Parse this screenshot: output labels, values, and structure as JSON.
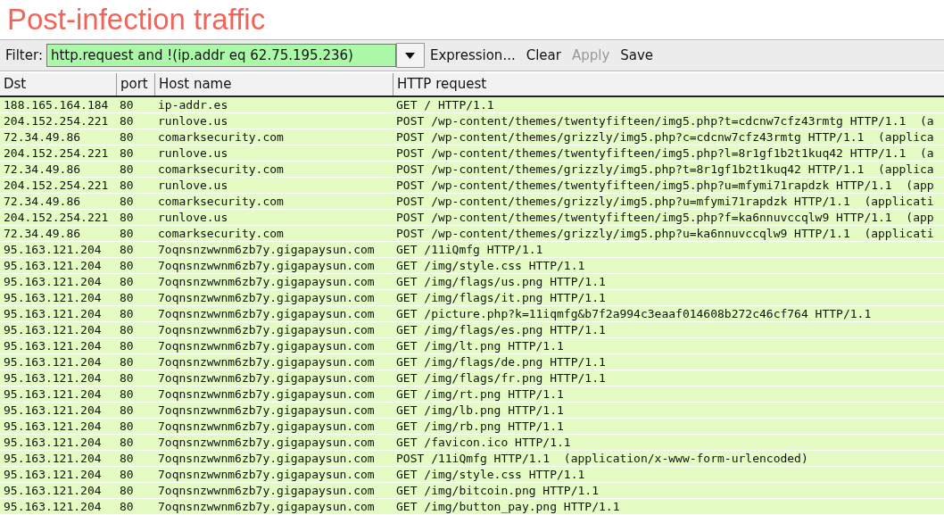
{
  "title": "Post-infection traffic",
  "filter": {
    "label": "Filter:",
    "value": "http.request and !(ip.addr eq 62.75.195.236)"
  },
  "toolbar": [
    {
      "label": "Expression...",
      "disabled": false
    },
    {
      "label": "Clear",
      "disabled": false
    },
    {
      "label": "Apply",
      "disabled": true
    },
    {
      "label": "Save",
      "disabled": false
    }
  ],
  "table": {
    "columns": [
      "Dst",
      "port",
      "Host name",
      "HTTP request"
    ],
    "rows": [
      [
        "188.165.164.184",
        "80",
        "ip-addr.es",
        "GET / HTTP/1.1"
      ],
      [
        "204.152.254.221",
        "80",
        "runlove.us",
        "POST /wp-content/themes/twentyfifteen/img5.php?t=cdcnw7cfz43rmtg HTTP/1.1  (a"
      ],
      [
        "72.34.49.86",
        "80",
        "comarksecurity.com",
        "POST /wp-content/themes/grizzly/img5.php?c=cdcnw7cfz43rmtg HTTP/1.1  (applica"
      ],
      [
        "204.152.254.221",
        "80",
        "runlove.us",
        "POST /wp-content/themes/twentyfifteen/img5.php?l=8r1gf1b2t1kuq42 HTTP/1.1  (a"
      ],
      [
        "72.34.49.86",
        "80",
        "comarksecurity.com",
        "POST /wp-content/themes/grizzly/img5.php?t=8r1gf1b2t1kuq42 HTTP/1.1  (applica"
      ],
      [
        "204.152.254.221",
        "80",
        "runlove.us",
        "POST /wp-content/themes/twentyfifteen/img5.php?u=mfymi71rapdzk HTTP/1.1  (app"
      ],
      [
        "72.34.49.86",
        "80",
        "comarksecurity.com",
        "POST /wp-content/themes/grizzly/img5.php?u=mfymi71rapdzk HTTP/1.1  (applicati"
      ],
      [
        "204.152.254.221",
        "80",
        "runlove.us",
        "POST /wp-content/themes/twentyfifteen/img5.php?f=ka6nnuvccqlw9 HTTP/1.1  (app"
      ],
      [
        "72.34.49.86",
        "80",
        "comarksecurity.com",
        "POST /wp-content/themes/grizzly/img5.php?u=ka6nnuvccqlw9 HTTP/1.1  (applicati"
      ],
      [
        "95.163.121.204",
        "80",
        "7oqnsnzwwnm6zb7y.gigapaysun.com",
        "GET /11iQmfg HTTP/1.1"
      ],
      [
        "95.163.121.204",
        "80",
        "7oqnsnzwwnm6zb7y.gigapaysun.com",
        "GET /img/style.css HTTP/1.1"
      ],
      [
        "95.163.121.204",
        "80",
        "7oqnsnzwwnm6zb7y.gigapaysun.com",
        "GET /img/flags/us.png HTTP/1.1"
      ],
      [
        "95.163.121.204",
        "80",
        "7oqnsnzwwnm6zb7y.gigapaysun.com",
        "GET /img/flags/it.png HTTP/1.1"
      ],
      [
        "95.163.121.204",
        "80",
        "7oqnsnzwwnm6zb7y.gigapaysun.com",
        "GET /picture.php?k=11iqmfg&b7f2a994c3eaaf014608b272c46cf764 HTTP/1.1"
      ],
      [
        "95.163.121.204",
        "80",
        "7oqnsnzwwnm6zb7y.gigapaysun.com",
        "GET /img/flags/es.png HTTP/1.1"
      ],
      [
        "95.163.121.204",
        "80",
        "7oqnsnzwwnm6zb7y.gigapaysun.com",
        "GET /img/lt.png HTTP/1.1"
      ],
      [
        "95.163.121.204",
        "80",
        "7oqnsnzwwnm6zb7y.gigapaysun.com",
        "GET /img/flags/de.png HTTP/1.1"
      ],
      [
        "95.163.121.204",
        "80",
        "7oqnsnzwwnm6zb7y.gigapaysun.com",
        "GET /img/flags/fr.png HTTP/1.1"
      ],
      [
        "95.163.121.204",
        "80",
        "7oqnsnzwwnm6zb7y.gigapaysun.com",
        "GET /img/rt.png HTTP/1.1"
      ],
      [
        "95.163.121.204",
        "80",
        "7oqnsnzwwnm6zb7y.gigapaysun.com",
        "GET /img/lb.png HTTP/1.1"
      ],
      [
        "95.163.121.204",
        "80",
        "7oqnsnzwwnm6zb7y.gigapaysun.com",
        "GET /img/rb.png HTTP/1.1"
      ],
      [
        "95.163.121.204",
        "80",
        "7oqnsnzwwnm6zb7y.gigapaysun.com",
        "GET /favicon.ico HTTP/1.1"
      ],
      [
        "95.163.121.204",
        "80",
        "7oqnsnzwwnm6zb7y.gigapaysun.com",
        "POST /11iQmfg HTTP/1.1  (application/x-www-form-urlencoded)"
      ],
      [
        "95.163.121.204",
        "80",
        "7oqnsnzwwnm6zb7y.gigapaysun.com",
        "GET /img/style.css HTTP/1.1"
      ],
      [
        "95.163.121.204",
        "80",
        "7oqnsnzwwnm6zb7y.gigapaysun.com",
        "GET /img/bitcoin.png HTTP/1.1"
      ],
      [
        "95.163.121.204",
        "80",
        "7oqnsnzwwnm6zb7y.gigapaysun.com",
        "GET /img/button_pay.png HTTP/1.1"
      ]
    ]
  }
}
